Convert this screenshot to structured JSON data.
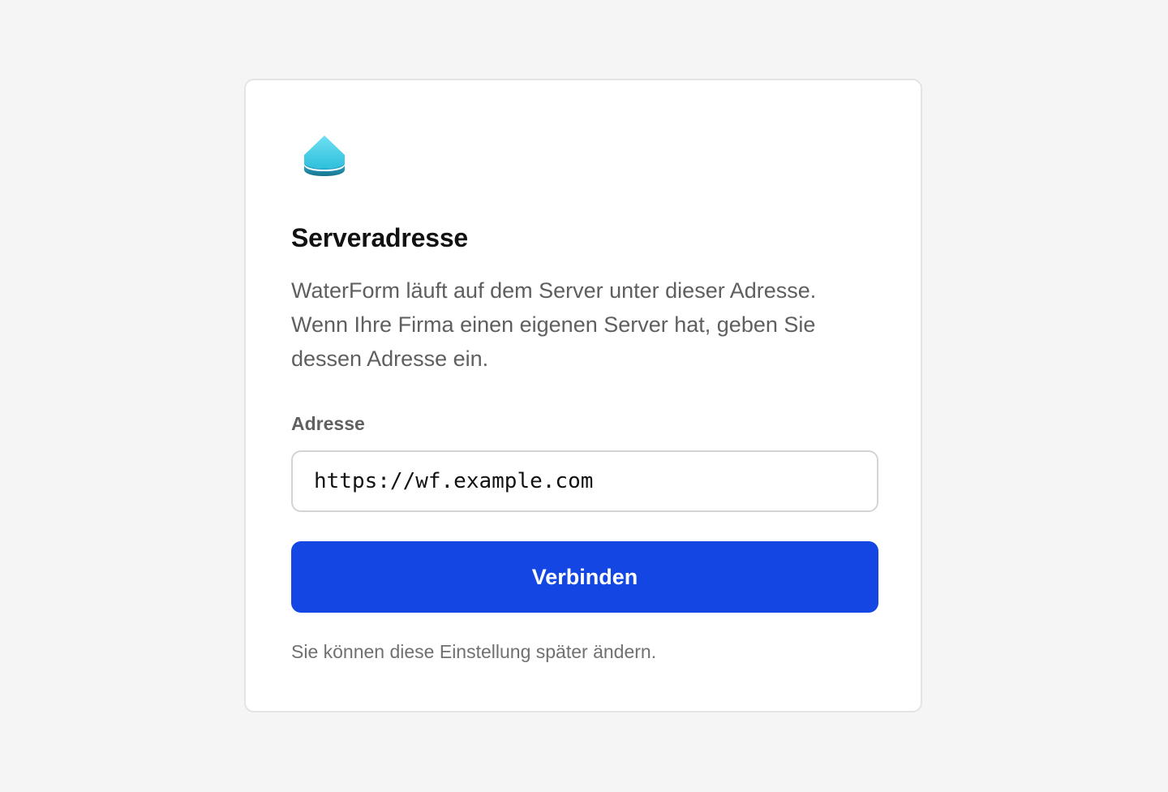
{
  "app": {
    "logo_icon": "stacked-disc-logo-icon",
    "colors": {
      "background": "#f5f5f5",
      "card": "#ffffff",
      "accent": "#1346e3",
      "logo_top": "#4fd3ea",
      "logo_bottom": "#1f8aa6"
    }
  },
  "card": {
    "title": "Serveradresse",
    "description": "WaterForm läuft auf dem Server unter dieser Adresse. Wenn Ihre Firma einen eigenen Server hat, geben Sie dessen Adresse ein.",
    "address_label": "Adresse",
    "address_value": "https://wf.example.com",
    "connect_label": "Verbinden",
    "hint": "Sie können diese Einstellung später ändern."
  }
}
